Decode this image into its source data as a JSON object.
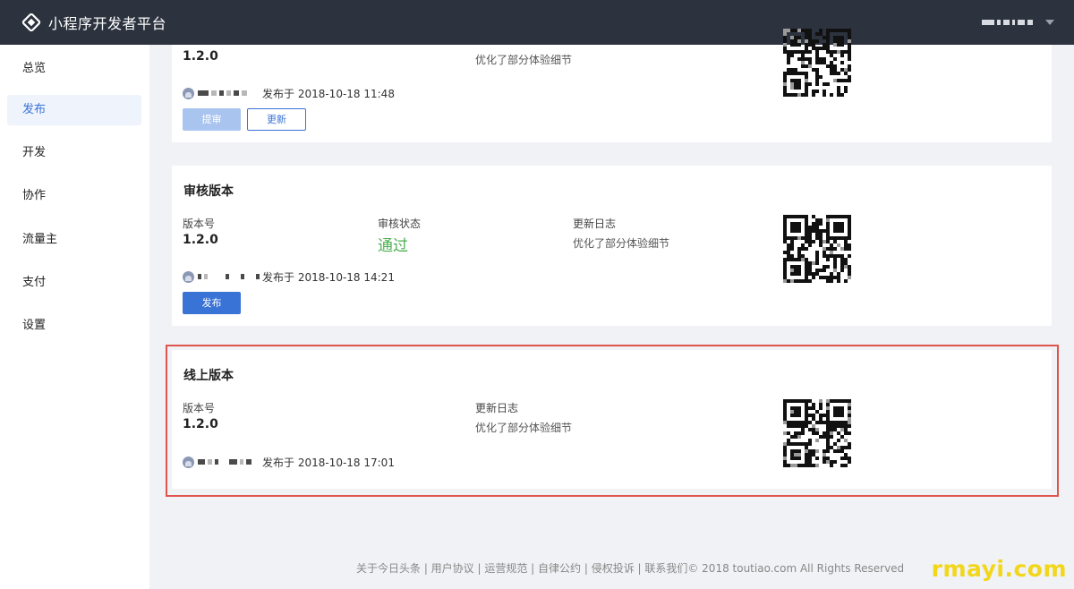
{
  "app": {
    "title": "小程序开发者平台"
  },
  "sidebar": {
    "items": [
      {
        "label": "总览"
      },
      {
        "label": "发布"
      },
      {
        "label": "开发"
      },
      {
        "label": "协作"
      },
      {
        "label": "流量主"
      },
      {
        "label": "支付"
      },
      {
        "label": "设置"
      }
    ],
    "active": "发布"
  },
  "dev_card": {
    "version": "1.2.0",
    "changelog": "优化了部分体验细节",
    "published": "发布于 2018-10-18 11:48",
    "submit_label": "提审",
    "update_label": "更新"
  },
  "review_card": {
    "title": "审核版本",
    "version_label": "版本号",
    "version": "1.2.0",
    "status_label": "审核状态",
    "status": "通过",
    "changelog_label": "更新日志",
    "changelog": "优化了部分体验细节",
    "published": "发布于 2018-10-18 14:21",
    "publish_label": "发布"
  },
  "online_card": {
    "title": "线上版本",
    "version_label": "版本号",
    "version": "1.2.0",
    "changelog_label": "更新日志",
    "changelog": "优化了部分体验细节",
    "published": "发布于 2018-10-18 17:01"
  },
  "footer": {
    "text": "关于今日头条 | 用户协议 | 运营规范 | 自律公约 | 侵权投诉 | 联系我们© 2018 toutiao.com All Rights Reserved"
  },
  "watermark": {
    "text": "rmayi.com"
  },
  "colors": {
    "topbar": "#2c333f",
    "accent": "#3a73d6",
    "pass": "#4caf50",
    "highlight": "#e0544e"
  }
}
